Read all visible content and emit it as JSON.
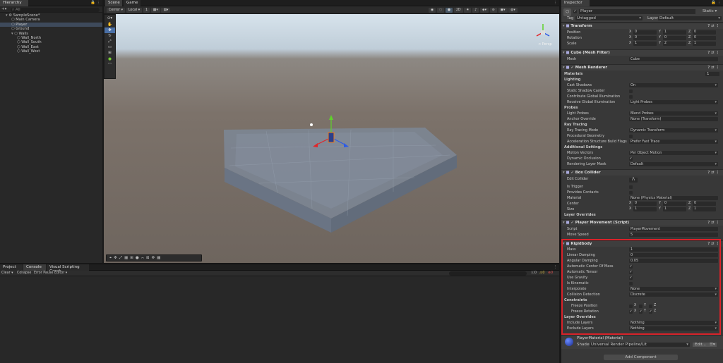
{
  "hierarchy": {
    "tab": "Hierarchy",
    "search_placeholder": "All",
    "items": [
      {
        "label": "SampleScene*",
        "indent": 0
      },
      {
        "label": "Main Camera",
        "indent": 1
      },
      {
        "label": "Player",
        "indent": 1,
        "selected": true
      },
      {
        "label": "Ground",
        "indent": 1
      },
      {
        "label": "Walls",
        "indent": 1
      },
      {
        "label": "Wall_North",
        "indent": 2
      },
      {
        "label": "Wall_South",
        "indent": 2
      },
      {
        "label": "Wall_East",
        "indent": 2
      },
      {
        "label": "Wall_West",
        "indent": 2
      }
    ]
  },
  "scene": {
    "tabs": [
      "Scene",
      "Game"
    ],
    "toolbar": {
      "pivot": "Center",
      "space": "Local",
      "grid": "1"
    },
    "persp_label": "< Persp"
  },
  "bottom": {
    "tabs": [
      "Project",
      "Console",
      "Visual Scripting Graph"
    ],
    "toolbar": {
      "clear": "Clear",
      "collapse": "Collapse",
      "error_pause": "Error Pause",
      "editor": "Editor"
    },
    "counts": [
      "0",
      "0",
      "0"
    ]
  },
  "inspector": {
    "tab": "Inspector",
    "object_name": "Player",
    "static_label": "Static",
    "tag_label": "Tag",
    "tag_value": "Untagged",
    "layer_label": "Layer",
    "layer_value": "Default",
    "transform": {
      "title": "Transform",
      "position": {
        "label": "Position",
        "x": "0",
        "y": "1",
        "z": "0"
      },
      "rotation": {
        "label": "Rotation",
        "x": "0",
        "y": "0",
        "z": "0"
      },
      "scale": {
        "label": "Scale",
        "x": "1",
        "y": "2",
        "z": "1"
      }
    },
    "mesh_filter": {
      "title": "Cube (Mesh Filter)",
      "mesh_label": "Mesh",
      "mesh_value": "Cube"
    },
    "mesh_renderer": {
      "title": "Mesh Renderer",
      "materials": "Materials",
      "materials_count": "1",
      "lighting": "Lighting",
      "cast_shadows": "Cast Shadows",
      "cast_shadows_value": "On",
      "static_shadow": "Static Shadow Caster",
      "contribute_gi": "Contribute Global Illumination",
      "receive_gi": "Receive Global Illumination",
      "receive_gi_value": "Light Probes",
      "probes": "Probes",
      "light_probes": "Light Probes",
      "light_probes_value": "Blend Probes",
      "anchor": "Anchor Override",
      "anchor_value": "None (Transform)",
      "ray_tracing": "Ray Tracing",
      "rt_mode": "Ray Tracing Mode",
      "rt_mode_value": "Dynamic Transform",
      "proc_geo": "Procedural Geometry",
      "accel": "Acceleration Structure Build Flags",
      "accel_value": "Prefer Fast Trace",
      "additional": "Additional Settings",
      "motion": "Motion Vectors",
      "motion_value": "Per Object Motion",
      "dyn_occ": "Dynamic Occlusion",
      "render_mask": "Rendering Layer Mask",
      "render_mask_value": "Default"
    },
    "box_collider": {
      "title": "Box Collider",
      "edit": "Edit Collider",
      "is_trigger": "Is Trigger",
      "provides": "Provides Contacts",
      "material": "Material",
      "material_value": "None (Physics Material)",
      "center": {
        "label": "Center",
        "x": "0",
        "y": "0",
        "z": "0"
      },
      "size": {
        "label": "Size",
        "x": "1",
        "y": "1",
        "z": "1"
      },
      "layer_overrides": "Layer Overrides"
    },
    "player_movement": {
      "title": "Player Movement (Script)",
      "script_label": "Script",
      "script_value": "PlayerMovement",
      "move_speed_label": "Move Speed",
      "move_speed_value": "5"
    },
    "rigidbody": {
      "title": "Rigidbody",
      "mass": "Mass",
      "mass_value": "1",
      "linear": "Linear Damping",
      "linear_value": "0",
      "angular": "Angular Damping",
      "angular_value": "0.05",
      "auto_com": "Automatic Center Of Mass",
      "auto_tensor": "Automatic Tensor",
      "use_gravity": "Use Gravity",
      "is_kinematic": "Is Kinematic",
      "interpolate": "Interpolate",
      "interpolate_value": "None",
      "collision": "Collision Detection",
      "collision_value": "Discrete",
      "constraints": "Constraints",
      "freeze_pos": "Freeze Position",
      "freeze_rot": "Freeze Rotation",
      "layer_overrides": "Layer Overrides",
      "include": "Include Layers",
      "include_value": "Nothing",
      "exclude": "Exclude Layers",
      "exclude_value": "Nothing"
    },
    "material": {
      "title": "PlayerMaterial (Material)",
      "shader_label": "Shader",
      "shader_value": "Universal Render Pipeline/Lit",
      "edit": "Edit..."
    },
    "add_component": "Add Component",
    "highlight_color": "#d9232a"
  }
}
